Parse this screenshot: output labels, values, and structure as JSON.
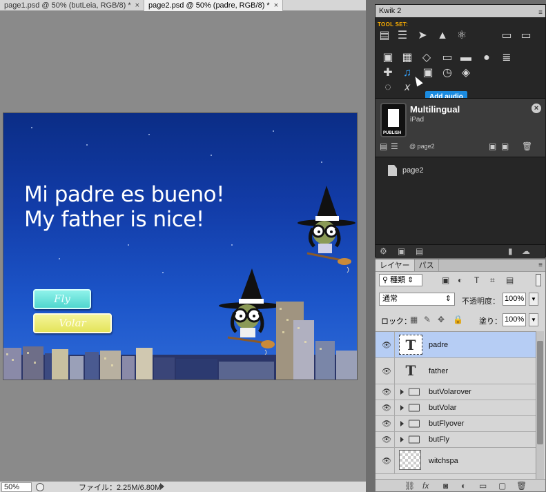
{
  "tabs": [
    {
      "label": "page1.psd @ 50% (butLeia, RGB/8) *",
      "close": "×"
    },
    {
      "label": "page2.psd @ 50% (padre, RGB/8) *",
      "close": "×"
    }
  ],
  "canvas": {
    "headline_line1": "Mi padre es bueno!",
    "headline_line2": "My father is nice!",
    "button_fly": "Fly",
    "button_volar": "Volar"
  },
  "status": {
    "zoom": "50%",
    "doc_info": "ファイル：2.25M/6.80M"
  },
  "kwik": {
    "title": "Kwik 2",
    "toolset_label": "TOOL SET:",
    "tooltip": "Add audio",
    "project_title": "Multilingual",
    "project_device": "iPad",
    "publish_label": "PUBLISH",
    "current_page": "@ page2",
    "page_item": "page2"
  },
  "layers_panel": {
    "tab_layers": "レイヤー",
    "tab_paths": "パス",
    "filter_kind": "種類",
    "blend_mode": "通常",
    "opacity_label": "不透明度：",
    "opacity_value": "100%",
    "lock_label": "ロック：",
    "fill_label": "塗り：",
    "fill_value": "100%",
    "layers": [
      {
        "name": "padre",
        "kind": "text",
        "selected": true
      },
      {
        "name": "father",
        "kind": "text"
      },
      {
        "name": "butVolarover",
        "kind": "group"
      },
      {
        "name": "butVolar",
        "kind": "group"
      },
      {
        "name": "butFlyover",
        "kind": "group"
      },
      {
        "name": "butFly",
        "kind": "group"
      },
      {
        "name": "witchspa",
        "kind": "pixel"
      }
    ]
  },
  "colors": {
    "accent_blue": "#1b8be0",
    "toolset_orange": "#ffb000",
    "selected_layer": "#b6cdf4"
  }
}
